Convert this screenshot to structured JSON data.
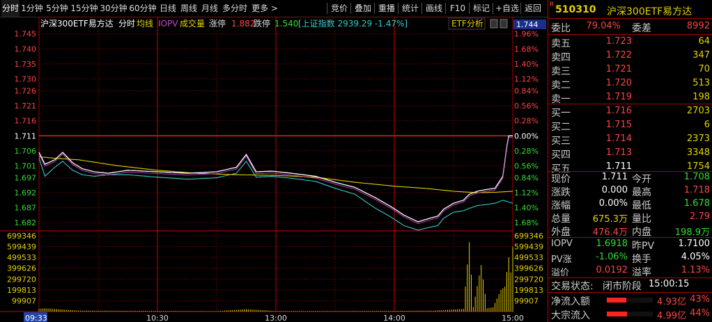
{
  "toolbar": {
    "period_tabs": [
      {
        "label": "分时",
        "active": true
      },
      {
        "label": "1分钟"
      },
      {
        "label": "5分钟"
      },
      {
        "label": "15分钟"
      },
      {
        "label": "30分钟"
      },
      {
        "label": "60分钟"
      },
      {
        "label": "日线"
      },
      {
        "label": "周线"
      },
      {
        "label": "月线"
      },
      {
        "label": "多分时"
      },
      {
        "label": "更多 >"
      }
    ],
    "tool_buttons": [
      {
        "label": "竞价"
      },
      {
        "label": "叠加"
      },
      {
        "label": "重播"
      },
      {
        "label": "统计"
      },
      {
        "label": "画线"
      },
      {
        "label": "F10"
      },
      {
        "label": "标记"
      },
      {
        "label": "+自选"
      },
      {
        "label": "返回"
      }
    ]
  },
  "chart_header": {
    "name": "沪深300ETF易方达",
    "mode": "分时",
    "avg_label": "均线",
    "iopv_label": "IOPV",
    "vol_label": "成交量",
    "limit_up_label": "涨停",
    "limit_up_value": "1.882",
    "limit_down_label": "跌停",
    "limit_down_value": "1.540",
    "index_label": "[上证指数 2939.29 -1.47%]",
    "etf_analysis_button": "ETF分析",
    "current_price_tag": "1.744"
  },
  "quote": {
    "marker": "R",
    "code": "510310",
    "name": "沪深300ETF易方达",
    "weibi_label": "委比",
    "weibi_value": "79.04%",
    "weicha_label": "委差",
    "weicha_value": "8992",
    "asks": [
      {
        "label": "卖五",
        "price": "1.723",
        "volume": "64"
      },
      {
        "label": "卖四",
        "price": "1.722",
        "volume": "347"
      },
      {
        "label": "卖三",
        "price": "1.721",
        "volume": "70"
      },
      {
        "label": "卖二",
        "price": "1.720",
        "volume": "513"
      },
      {
        "label": "卖一",
        "price": "1.719",
        "volume": "198"
      }
    ],
    "bids": [
      {
        "label": "买一",
        "price": "1.716",
        "volume": "2703"
      },
      {
        "label": "买二",
        "price": "1.715",
        "volume": "6"
      },
      {
        "label": "买三",
        "price": "1.714",
        "volume": "2373"
      },
      {
        "label": "买四",
        "price": "1.713",
        "volume": "3348"
      },
      {
        "label": "买五",
        "price": "1.711",
        "volume": "1754"
      }
    ],
    "stats": [
      {
        "l1": "现价",
        "v1": "1.711",
        "c1": "#ffffff",
        "l2": "今开",
        "v2": "1.708",
        "c2": "#33dd33"
      },
      {
        "l1": "涨跌",
        "v1": "0.000",
        "c1": "#ffffff",
        "l2": "最高",
        "v2": "1.718",
        "c2": "#ff4444"
      },
      {
        "l1": "涨幅",
        "v1": "0.00%",
        "c1": "#ffffff",
        "l2": "最低",
        "v2": "1.678",
        "c2": "#33dd33"
      },
      {
        "l1": "总量",
        "v1": "675.3万",
        "c1": "#e6d200",
        "l2": "量比",
        "v2": "2.79",
        "c2": "#ff4444"
      },
      {
        "l1": "外盘",
        "v1": "476.4万",
        "c1": "#ff4444",
        "l2": "内盘",
        "v2": "198.9万",
        "c2": "#33dd33"
      }
    ],
    "iopv_rows": [
      {
        "l1": "IOPV",
        "v1": "1.6918",
        "c1": "#33dd33",
        "l2": "昨PV",
        "v2": "1.7100",
        "c2": "#ffffff"
      },
      {
        "l1": "PV涨",
        "v1": "-1.06%",
        "c1": "#33dd33",
        "l2": "换手",
        "v2": "4.05%",
        "c2": "#ffffff"
      },
      {
        "l1": "溢价",
        "v1": "0.0192",
        "c1": "#ff4444",
        "l2": "溢率",
        "v2": "1.13%",
        "c2": "#ff4444"
      }
    ],
    "trade_status_label": "交易状态:",
    "trade_status_value": "闭市阶段",
    "trade_time": "15:00:15",
    "flows": [
      {
        "label": "净流入额",
        "amount": "4.93亿",
        "pct": "43%",
        "fill": 0.43
      },
      {
        "label": "大宗流入",
        "amount": "4.99亿",
        "pct": "44%",
        "fill": 0.44
      }
    ]
  },
  "chart_data": {
    "type": "line",
    "prev_close": 1.711,
    "price_axis_ticks": [
      "1.745",
      "1.740",
      "1.735",
      "1.730",
      "1.726",
      "1.721",
      "1.716",
      "1.711",
      "1.706",
      "1.701",
      "1.697",
      "1.692",
      "1.687",
      "1.682"
    ],
    "pct_axis_ticks": [
      "1.96%",
      "1.68%",
      "1.40%",
      "1.12%",
      "0.84%",
      "0.56%",
      "0.28%",
      "0.00%",
      "0.28%",
      "0.56%",
      "0.84%",
      "1.12%",
      "1.40%",
      "1.68%"
    ],
    "ylim": [
      1.6795,
      1.7461
    ],
    "volume_axis_ticks": [
      "699346",
      "599439",
      "499533",
      "399626",
      "299720",
      "199813",
      "99907"
    ],
    "volume_ylim": [
      0,
      699346
    ],
    "x_labels": [
      "09:33",
      "10:30",
      "13:00",
      "14:00",
      "15:00"
    ],
    "x_label_positions_min": [
      3,
      60,
      120,
      180,
      240
    ],
    "x_points": 241,
    "series": [
      {
        "name": "IOPV",
        "color": "#33cccc",
        "anchors": [
          [
            0,
            1.7036
          ],
          [
            3,
            1.6975
          ],
          [
            8,
            1.7005
          ],
          [
            12,
            1.7025
          ],
          [
            17,
            1.6995
          ],
          [
            22,
            1.698
          ],
          [
            28,
            1.6975
          ],
          [
            35,
            1.698
          ],
          [
            45,
            1.698
          ],
          [
            60,
            1.6972
          ],
          [
            75,
            1.6965
          ],
          [
            90,
            1.697
          ],
          [
            100,
            1.6985
          ],
          [
            105,
            1.7025
          ],
          [
            110,
            1.6972
          ],
          [
            118,
            1.6975
          ],
          [
            128,
            1.6968
          ],
          [
            140,
            1.6958
          ],
          [
            150,
            1.6935
          ],
          [
            160,
            1.6915
          ],
          [
            170,
            1.687
          ],
          [
            178,
            1.684
          ],
          [
            185,
            1.681
          ],
          [
            192,
            1.6795
          ],
          [
            198,
            1.6805
          ],
          [
            202,
            1.681
          ],
          [
            205,
            1.6835
          ],
          [
            210,
            1.6855
          ],
          [
            215,
            1.686
          ],
          [
            218,
            1.6868
          ],
          [
            222,
            1.6877
          ],
          [
            226,
            1.688
          ],
          [
            231,
            1.6885
          ],
          [
            235,
            1.6895
          ],
          [
            240,
            1.6885
          ]
        ]
      },
      {
        "name": "均线",
        "color": "#e6d200",
        "anchors": [
          [
            0,
            1.704
          ],
          [
            8,
            1.7035
          ],
          [
            20,
            1.703
          ],
          [
            40,
            1.701
          ],
          [
            60,
            1.6995
          ],
          [
            80,
            1.6985
          ],
          [
            100,
            1.698
          ],
          [
            120,
            1.6978
          ],
          [
            140,
            1.6972
          ],
          [
            160,
            1.6955
          ],
          [
            180,
            1.6942
          ],
          [
            195,
            1.6935
          ],
          [
            210,
            1.6925
          ],
          [
            222,
            1.692
          ],
          [
            232,
            1.6922
          ],
          [
            240,
            1.6925
          ]
        ]
      },
      {
        "name": "现价",
        "color": "#ffffff",
        "anchors": [
          [
            0,
            1.7055
          ],
          [
            3,
            1.7015
          ],
          [
            8,
            1.703
          ],
          [
            12,
            1.7055
          ],
          [
            17,
            1.702
          ],
          [
            22,
            1.7
          ],
          [
            28,
            1.699
          ],
          [
            35,
            1.6985
          ],
          [
            45,
            1.6995
          ],
          [
            60,
            1.699
          ],
          [
            75,
            1.6985
          ],
          [
            90,
            1.699
          ],
          [
            100,
            1.7005
          ],
          [
            105,
            1.7048
          ],
          [
            110,
            1.699
          ],
          [
            118,
            1.6992
          ],
          [
            128,
            1.6985
          ],
          [
            140,
            1.6975
          ],
          [
            150,
            1.6955
          ],
          [
            160,
            1.6938
          ],
          [
            170,
            1.6905
          ],
          [
            178,
            1.6875
          ],
          [
            185,
            1.6845
          ],
          [
            192,
            1.6823
          ],
          [
            198,
            1.6835
          ],
          [
            202,
            1.6842
          ],
          [
            205,
            1.6865
          ],
          [
            210,
            1.6885
          ],
          [
            215,
            1.6895
          ],
          [
            218,
            1.6915
          ],
          [
            222,
            1.6925
          ],
          [
            226,
            1.693
          ],
          [
            231,
            1.6935
          ],
          [
            235,
            1.6975
          ],
          [
            237,
            1.7075
          ],
          [
            238,
            1.711
          ],
          [
            240,
            1.711
          ]
        ]
      }
    ],
    "volume_anchors": [
      [
        0,
        25000
      ],
      [
        3,
        30000
      ],
      [
        20,
        8000
      ],
      [
        60,
        6000
      ],
      [
        90,
        4000
      ],
      [
        105,
        22000
      ],
      [
        120,
        5000
      ],
      [
        150,
        5000
      ],
      [
        180,
        6000
      ],
      [
        200,
        8000
      ],
      [
        215,
        25000
      ],
      [
        218,
        640000
      ],
      [
        220,
        40000
      ],
      [
        224,
        430000
      ],
      [
        227,
        30000
      ],
      [
        230,
        40000
      ],
      [
        234,
        200000
      ],
      [
        236,
        230000
      ],
      [
        238,
        500000
      ],
      [
        239,
        360000
      ],
      [
        240,
        600000
      ]
    ]
  }
}
